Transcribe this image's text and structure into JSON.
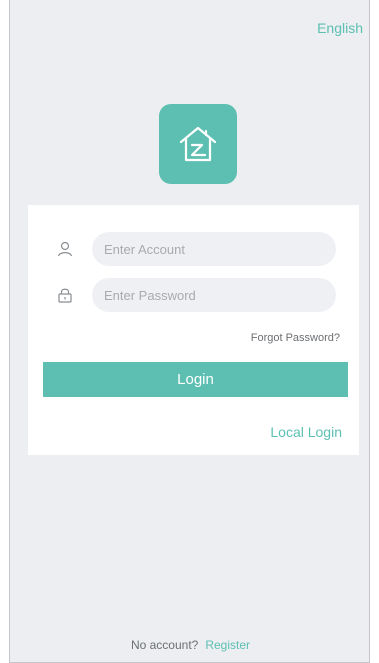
{
  "header": {
    "language_label": "English"
  },
  "logo": {
    "icon": "home-icon",
    "color": "#5cbfb1"
  },
  "login_form": {
    "account": {
      "icon": "user-icon",
      "placeholder": "Enter Account",
      "value": ""
    },
    "password": {
      "icon": "lock-icon",
      "placeholder": "Enter Password",
      "value": ""
    },
    "forgot_label": "Forgot Password?",
    "login_label": "Login",
    "local_login_label": "Local Login"
  },
  "footer": {
    "no_account_label": "No account?",
    "register_label": "Register"
  },
  "colors": {
    "accent": "#5cbfb1",
    "background": "#eceef1",
    "card": "#ffffff"
  }
}
